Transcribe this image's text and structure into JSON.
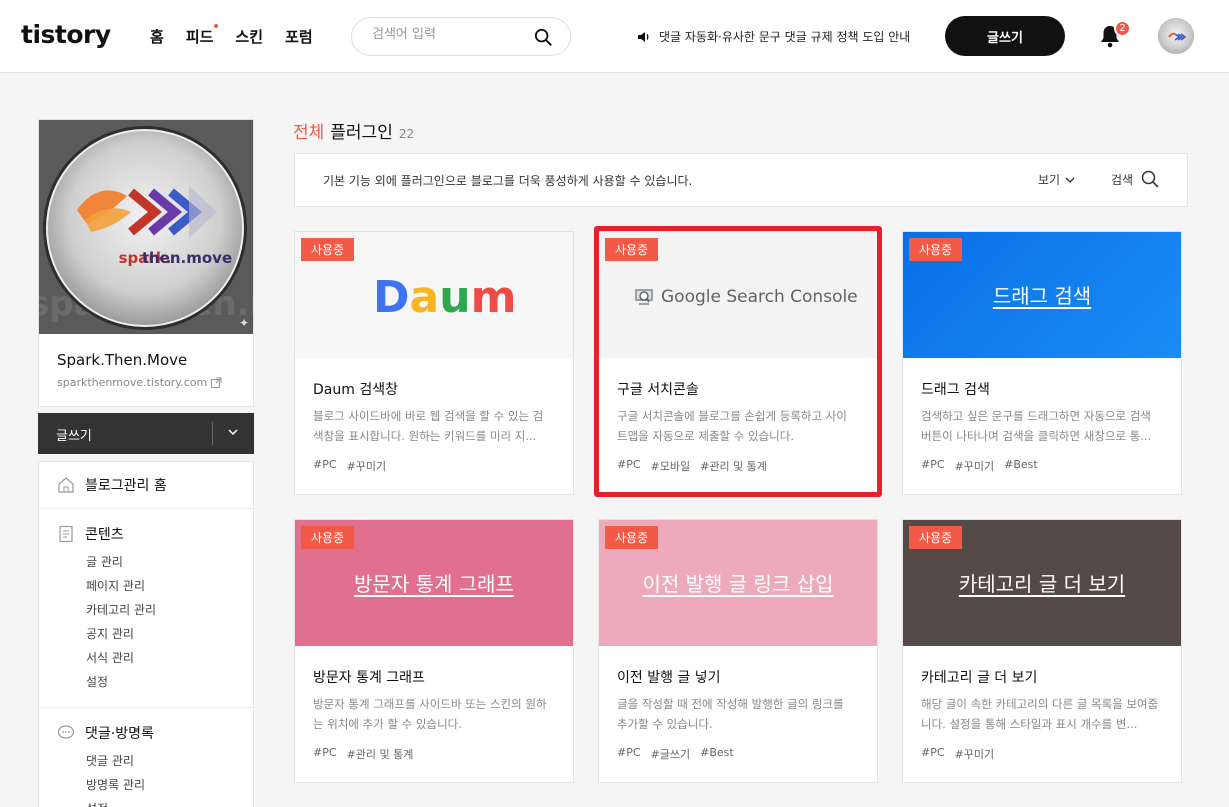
{
  "header": {
    "logo": "tistory",
    "nav": [
      "홈",
      "피드",
      "스킨",
      "포럼"
    ],
    "search_placeholder": "검색어 입력",
    "notice": "댓글 자동화·유사한 문구 댓글 규제 정책 도입 안내",
    "write_button": "글쓰기",
    "notification_count": "2"
  },
  "sidebar": {
    "blog_name": "Spark.Then.Move",
    "blog_url": "sparkthenmove.tistory.com",
    "logo_text": "spark.then.move",
    "write_button": "글쓰기",
    "sections": [
      {
        "title": "블로그관리 홈",
        "items": []
      },
      {
        "title": "콘텐츠",
        "items": [
          "글 관리",
          "페이지 관리",
          "카테고리 관리",
          "공지 관리",
          "서식 관리",
          "설정"
        ]
      },
      {
        "title": "댓글·방명록",
        "items": [
          "댓글 관리",
          "방명록 관리",
          "설정"
        ]
      }
    ]
  },
  "main": {
    "title_accent": "전체",
    "title": "플러그인",
    "count": "22",
    "description": "기본 기능 외에 플러그인으로 블로그를 더욱 풍성하게 사용할 수 있습니다.",
    "view_label": "보기",
    "search_label": "검색",
    "cards": [
      {
        "tag": "사용중",
        "thumb_text": "Daum",
        "title": "Daum 검색창",
        "desc": "블로그 사이드바에 바로 웹 검색을 할 수 있는 검색창을 표시합니다. 원하는 키워드를 미리 지...",
        "tags": [
          "#PC",
          "#꾸미기"
        ]
      },
      {
        "tag": "사용중",
        "thumb_text": "Google Search Console",
        "title": "구글 서치콘솔",
        "desc": "구글 서치콘솔에 블로그를 손쉽게 등록하고 사이트맵을 자동으로 제출할 수 있습니다.",
        "tags": [
          "#PC",
          "#모바일",
          "#관리 및 통계"
        ]
      },
      {
        "tag": "사용중",
        "thumb_text": "드래그 검색",
        "title": "드래그 검색",
        "desc": "검색하고 싶은 문구를 드래그하면 자동으로 검색 버튼이 나타나며 검색을 클릭하면 새창으로 통...",
        "tags": [
          "#PC",
          "#꾸미기",
          "#Best"
        ]
      },
      {
        "tag": "사용중",
        "thumb_text": "방문자 통계 그래프",
        "title": "방문자 통계 그래프",
        "desc": "방문자 통계 그래프를 사이드바 또는 스킨의 원하는 위치에 추가 할 수 있습니다.",
        "tags": [
          "#PC",
          "#관리 및 통계"
        ]
      },
      {
        "tag": "사용중",
        "thumb_text": "이전 발행 글 링크 삽입",
        "title": "이전 발행 글 넣기",
        "desc": "글을 작성할 때 전에 작성해 발행한 글의 링크를 추가할 수 있습니다.",
        "tags": [
          "#PC",
          "#글쓰기",
          "#Best"
        ]
      },
      {
        "tag": "사용중",
        "thumb_text": "카테고리 글 더 보기",
        "title": "카테고리 글 더 보기",
        "desc": "해당 글이 속한 카테고리의 다른 글 목록을 보여줍니다. 설정을 통해 스타일과 표시 개수를 변...",
        "tags": [
          "#PC",
          "#꾸미기"
        ]
      }
    ]
  },
  "colors": {
    "accent": "#f15a45",
    "highlight": "#e8202b",
    "drag_blue": "#0f7ef0",
    "visitor_pink": "#e0708e",
    "prev_pink": "#eeaabd",
    "category_brown": "#554a48"
  }
}
